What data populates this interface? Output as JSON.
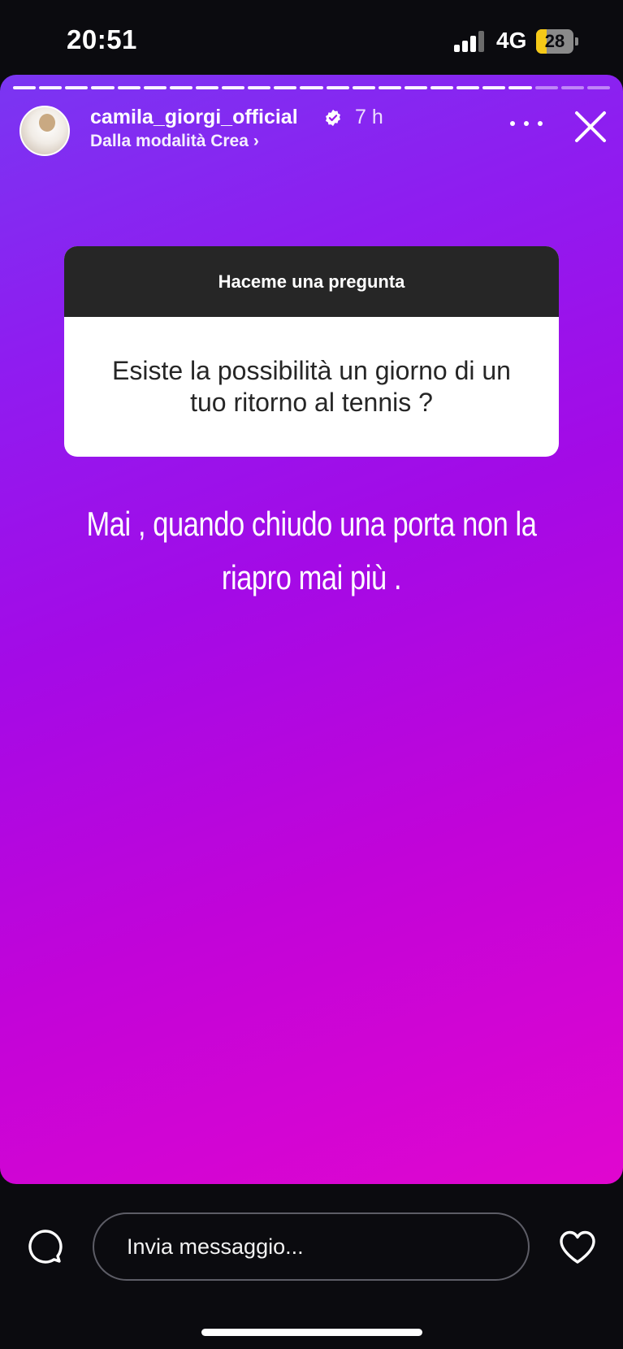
{
  "status_bar": {
    "time": "20:51",
    "network": "4G",
    "battery": "28",
    "battery_level": 0.28,
    "signal_bars": 3
  },
  "story": {
    "username": "camila_giorgi_official",
    "verified": true,
    "time_ago": "7 h",
    "subtitle": "Dalla modalità Crea",
    "segments_total": 23,
    "segments_viewed": 20,
    "question_box": {
      "header": "Haceme una pregunta",
      "question": "Esiste la possibilità un giorno di un tuo ritorno al tennis ?"
    },
    "answer_text": "Mai , quando chiudo una porta non la riapro mai più .",
    "icons": {
      "more": "more-horizontal-icon",
      "close": "close-icon",
      "verified": "verified-badge-icon"
    },
    "colors": {
      "gradient_start": "#7a36f2",
      "gradient_end": "#e006cf"
    }
  },
  "bottom_bar": {
    "message_placeholder": "Invia messaggio...",
    "icons": {
      "camera": "camera-icon",
      "like": "heart-icon"
    }
  }
}
